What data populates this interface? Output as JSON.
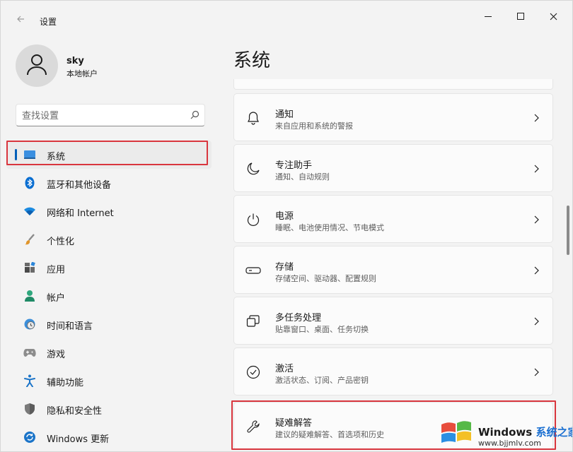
{
  "window": {
    "title": "设置"
  },
  "user": {
    "name": "sky",
    "account_type": "本地帐户"
  },
  "search": {
    "placeholder": "查找设置"
  },
  "sidebar": {
    "items": [
      {
        "label": "系统",
        "icon": "monitor-icon",
        "active": true
      },
      {
        "label": "蓝牙和其他设备",
        "icon": "bluetooth-icon"
      },
      {
        "label": "网络和 Internet",
        "icon": "wifi-icon"
      },
      {
        "label": "个性化",
        "icon": "brush-icon"
      },
      {
        "label": "应用",
        "icon": "apps-icon"
      },
      {
        "label": "帐户",
        "icon": "person-icon"
      },
      {
        "label": "时间和语言",
        "icon": "clock-globe-icon"
      },
      {
        "label": "游戏",
        "icon": "gamepad-icon"
      },
      {
        "label": "辅助功能",
        "icon": "accessibility-icon"
      },
      {
        "label": "隐私和安全性",
        "icon": "shield-icon"
      },
      {
        "label": "Windows 更新",
        "icon": "update-icon"
      }
    ]
  },
  "main": {
    "title": "系统",
    "cards": [
      {
        "title": "通知",
        "desc": "来自应用和系统的警报",
        "icon": "bell-icon"
      },
      {
        "title": "专注助手",
        "desc": "通知、自动规则",
        "icon": "moon-icon"
      },
      {
        "title": "电源",
        "desc": "睡眠、电池使用情况、节电模式",
        "icon": "power-icon"
      },
      {
        "title": "存储",
        "desc": "存储空间、驱动器、配置规则",
        "icon": "storage-icon"
      },
      {
        "title": "多任务处理",
        "desc": "贴靠窗口、桌面、任务切换",
        "icon": "multitask-icon"
      },
      {
        "title": "激活",
        "desc": "激活状态、订阅、产品密钥",
        "icon": "check-circle-icon"
      },
      {
        "title": "疑难解答",
        "desc": "建议的疑难解答、首选项和历史",
        "icon": "wrench-icon"
      }
    ]
  },
  "watermark": {
    "brand": "Windows",
    "brand_cn": "系统之家",
    "url": "www.bjjmlv.com"
  },
  "colors": {
    "accent": "#005fb8",
    "highlight": "#d9363e",
    "background": "#f3f3f3"
  }
}
